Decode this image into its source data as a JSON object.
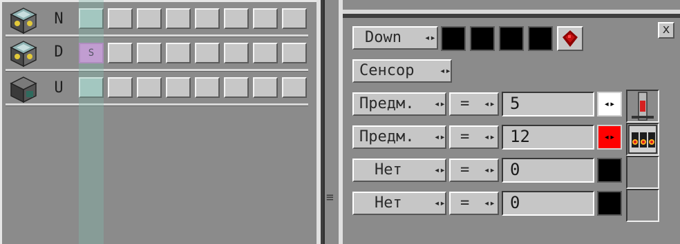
{
  "left_panel": {
    "rows": [
      {
        "face": "N",
        "icon": "nuclear-block-icon",
        "special_slot": ""
      },
      {
        "face": "D",
        "icon": "nuclear-block-icon",
        "special_slot": "S"
      },
      {
        "face": "U",
        "icon": "machine-block-icon",
        "special_slot": ""
      }
    ]
  },
  "right_panel": {
    "direction_button": "Down",
    "sensor_button": "Сенсор",
    "close_label": "x",
    "redstone_icon": "redstone-dust-icon",
    "rules": [
      {
        "item_label": "Предм.",
        "op_label": "=",
        "value": "5",
        "color": "#ffffff"
      },
      {
        "item_label": "Предм.",
        "op_label": "=",
        "value": "12",
        "color": "#ff0000"
      },
      {
        "item_label": "Нет",
        "op_label": "=",
        "value": "0",
        "color": "#000000"
      },
      {
        "item_label": "Нет",
        "op_label": "=",
        "value": "0",
        "color": "#000000"
      }
    ],
    "arrow_glyph": "◂▸",
    "grip_glyph": "≡"
  }
}
